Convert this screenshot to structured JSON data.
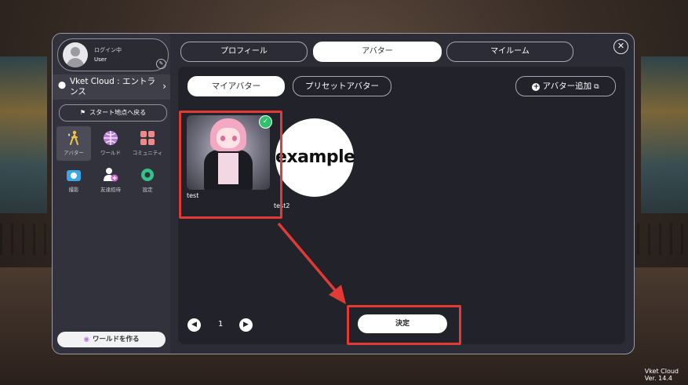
{
  "user": {
    "login_label": "ログイン中",
    "name": "User"
  },
  "location": {
    "text": "Vket Cloud : エントランス"
  },
  "sidebar": {
    "back_label": "スタート地点へ戻る",
    "menu": [
      {
        "label": "アバター",
        "icon": "avatar-icon"
      },
      {
        "label": "ワールド",
        "icon": "globe-icon"
      },
      {
        "label": "コミュニティ",
        "icon": "community-icon"
      },
      {
        "label": "撮影",
        "icon": "camera-icon"
      },
      {
        "label": "友達招待",
        "icon": "add-friend-icon"
      },
      {
        "label": "設定",
        "icon": "gear-icon"
      }
    ],
    "create_world_label": "ワールドを作る"
  },
  "tabs": [
    {
      "label": "プロフィール"
    },
    {
      "label": "アバター"
    },
    {
      "label": "マイルーム"
    }
  ],
  "sub_tabs": [
    {
      "label": "マイアバター"
    },
    {
      "label": "プリセットアバター"
    }
  ],
  "add_avatar_label": "アバター追加",
  "avatars": [
    {
      "name": "test",
      "selected": true
    },
    {
      "name": "test2",
      "thumbnail_text": "example"
    }
  ],
  "pager": {
    "current_page": "1"
  },
  "decide_label": "決定",
  "version": {
    "line1": "Vket Cloud",
    "line2": "Ver. 14.4"
  },
  "colors": {
    "highlight": "#e23b35",
    "check": "#2ec36b",
    "panel": "#2b2c35"
  }
}
